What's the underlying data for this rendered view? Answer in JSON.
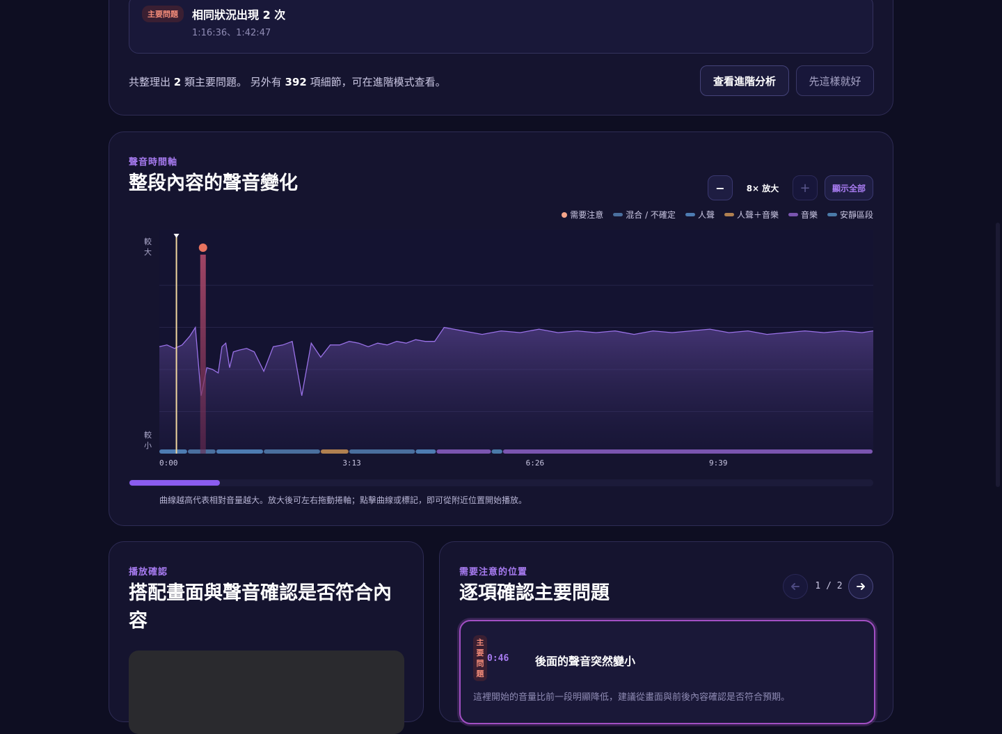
{
  "issue_card": {
    "badge": "主要問題",
    "title": "相同狀況出現 2 次",
    "times": "1:16:36、1:42:47",
    "summary_pre": "共整理出 ",
    "summary_count_main": "2",
    "summary_mid": " 類主要問題。 另外有 ",
    "summary_count_detail": "392",
    "summary_post": " 項細節，可在進階模式查看。",
    "advanced_button": "查看進階分析",
    "dismiss_button": "先這樣就好"
  },
  "timeline": {
    "eyebrow": "聲音時間軸",
    "title": "整段內容的聲音變化",
    "zoom_out": "−",
    "zoom_label": "8× 放大",
    "zoom_in": "+",
    "show_all": "顯示全部",
    "legend": [
      {
        "label": "需要注意",
        "color": "#f5a58a",
        "shape": "dot"
      },
      {
        "label": "混合 / 不確定",
        "color": "#4a6f9e",
        "shape": "bar"
      },
      {
        "label": "人聲",
        "color": "#4d7cb2",
        "shape": "bar"
      },
      {
        "label": "人聲＋音樂",
        "color": "#b08050",
        "shape": "bar"
      },
      {
        "label": "音樂",
        "color": "#7a55b0",
        "shape": "bar"
      },
      {
        "label": "安靜區段",
        "color": "#4a7aa8",
        "shape": "bar"
      }
    ],
    "y_top": "較大",
    "y_bottom": "較小",
    "help": "曲線越高代表相對音量越大。放大後可左右拖動捲軸；點擊曲線或標記，即可從附近位置開始播放。"
  },
  "chart_data": {
    "type": "area",
    "title": "",
    "xlabel": "",
    "ylabel": "",
    "x_ticks": [
      "0:00",
      "3:13",
      "6:26",
      "9:39"
    ],
    "x_range_seconds": [
      0,
      752
    ],
    "ylim": [
      0,
      1
    ],
    "grid": true,
    "legend_position": "top-right",
    "series": [
      {
        "type": "area",
        "x": [
          0,
          8,
          16,
          24,
          32,
          38,
          44,
          50,
          56,
          62,
          66,
          70,
          74,
          78,
          84,
          92,
          100,
          110,
          120,
          130,
          140,
          150,
          160,
          170,
          180,
          190,
          200,
          210,
          220,
          230,
          240,
          250,
          260,
          270,
          280,
          290,
          300,
          320,
          340,
          360,
          380,
          400,
          420,
          440,
          460,
          480,
          500,
          520,
          540,
          560,
          580,
          600,
          620,
          640,
          660,
          680,
          700,
          720,
          740,
          752
        ],
        "values": [
          0.61,
          0.62,
          0.6,
          0.62,
          0.67,
          0.72,
          0.33,
          0.49,
          0.48,
          0.46,
          0.61,
          0.63,
          0.49,
          0.58,
          0.59,
          0.6,
          0.58,
          0.47,
          0.61,
          0.62,
          0.64,
          0.33,
          0.63,
          0.55,
          0.62,
          0.62,
          0.64,
          0.63,
          0.61,
          0.63,
          0.62,
          0.64,
          0.63,
          0.65,
          0.64,
          0.64,
          0.72,
          0.7,
          0.68,
          0.7,
          0.69,
          0.71,
          0.69,
          0.7,
          0.69,
          0.7,
          0.68,
          0.7,
          0.69,
          0.7,
          0.71,
          0.69,
          0.7,
          0.68,
          0.69,
          0.7,
          0.69,
          0.7,
          0.69,
          0.7
        ]
      }
    ],
    "markers": [
      {
        "x": 18,
        "label": "playhead",
        "color": "#f0d6a0"
      },
      {
        "x": 46,
        "label": "需要注意",
        "color": "#e8735f"
      }
    ],
    "segments": [
      {
        "start": 0,
        "end": 30,
        "kind": "人聲"
      },
      {
        "start": 30,
        "end": 60,
        "kind": "混合 / 不確定"
      },
      {
        "start": 60,
        "end": 110,
        "kind": "人聲"
      },
      {
        "start": 110,
        "end": 170,
        "kind": "混合 / 不確定"
      },
      {
        "start": 170,
        "end": 200,
        "kind": "人聲＋音樂"
      },
      {
        "start": 200,
        "end": 270,
        "kind": "混合 / 不確定"
      },
      {
        "start": 270,
        "end": 292,
        "kind": "人聲"
      },
      {
        "start": 292,
        "end": 350,
        "kind": "音樂"
      },
      {
        "start": 350,
        "end": 362,
        "kind": "安靜區段"
      },
      {
        "start": 362,
        "end": 752,
        "kind": "音樂"
      }
    ]
  },
  "playback": {
    "eyebrow": "播放確認",
    "title_line1": "搭配畫面與聲音確認是否符合內",
    "title_line2": "容"
  },
  "review": {
    "eyebrow": "需要注意的位置",
    "title": "逐項確認主要問題",
    "pager": "1 / 2",
    "item_badge": "主要問題",
    "item_time": "0:46",
    "item_title": "後面的聲音突然變小",
    "item_desc": "這裡開始的音量比前一段明顯降低，建議從畫面與前後內容確認是否符合預期。"
  }
}
